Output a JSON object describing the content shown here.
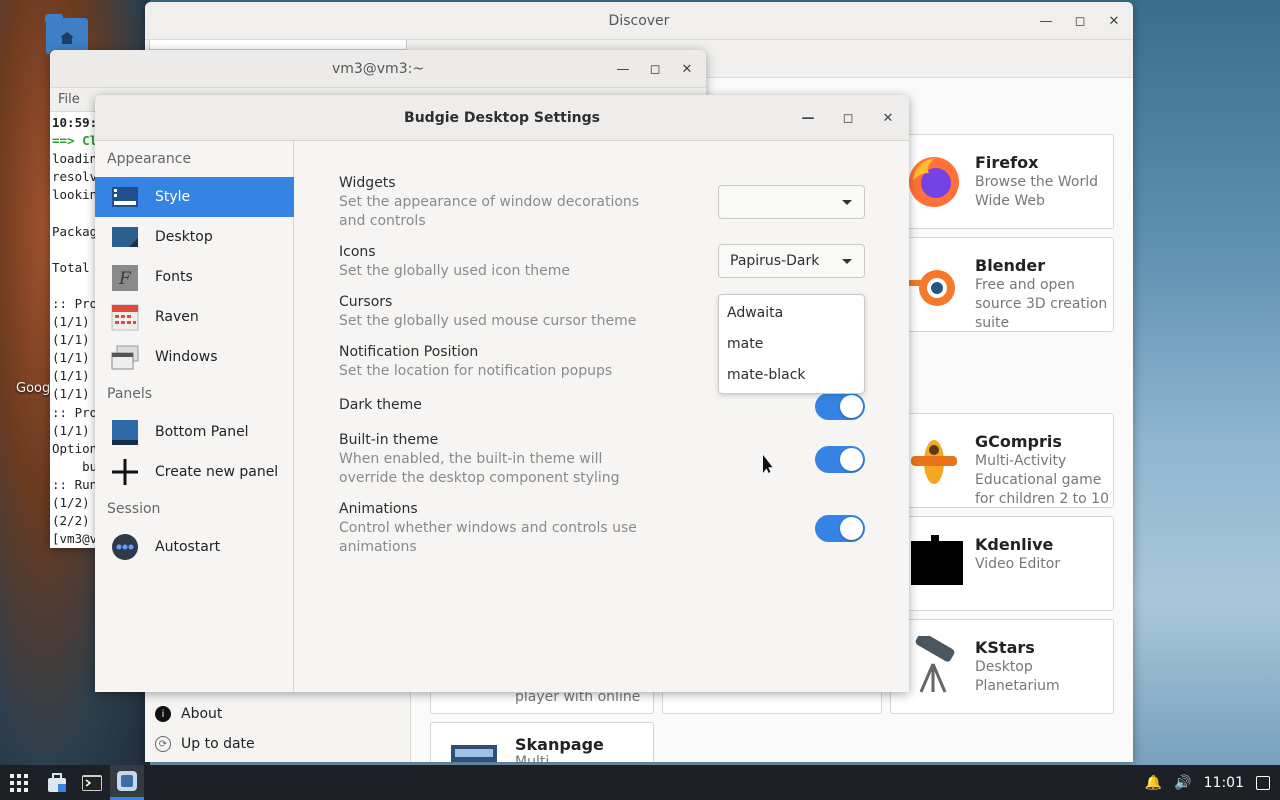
{
  "desktop": {
    "label": "Goog"
  },
  "discover": {
    "title": "Discover",
    "sidebar": {
      "about": "About",
      "up_to_date": "Up to date"
    },
    "cards": [
      {
        "name": "Firefox",
        "desc": "Browse the World Wide Web"
      },
      {
        "name": "Blender",
        "desc": "Free and open source 3D creation suite"
      },
      {
        "name": "GCompris",
        "desc": "Multi-Activity Educational game for children 2 to 10"
      },
      {
        "name": "Kdenlive",
        "desc": "Video Editor"
      },
      {
        "name": "KStars",
        "desc": "Desktop Planetarium"
      },
      {
        "name": "Skanpage",
        "desc": "Multi..."
      }
    ],
    "partial_card_text": "player with online"
  },
  "terminal": {
    "title": "vm3@vm3:~",
    "menu_file": "File",
    "lines": [
      "10:59:",
      "==> Cl",
      "loadin",
      "resolv",
      "lookin",
      "",
      "Packag",
      "",
      "Total",
      "",
      ":: Pro",
      "(1/1)",
      "(1/1)",
      "(1/1)",
      "(1/1)",
      "(1/1)",
      ":: Pro",
      "(1/1)",
      "Option",
      "    bu",
      ":: Run",
      "(1/2)",
      "(2/2)",
      "[vm3@v"
    ]
  },
  "budgie": {
    "title": "Budgie Desktop Settings",
    "sections": {
      "appearance": "Appearance",
      "panels": "Panels",
      "session": "Session"
    },
    "items": {
      "style": "Style",
      "desktop": "Desktop",
      "fonts": "Fonts",
      "raven": "Raven",
      "windows": "Windows",
      "bottom_panel": "Bottom Panel",
      "create_panel": "Create new panel",
      "autostart": "Autostart"
    },
    "options": {
      "widgets_title": "Widgets",
      "widgets_desc": "Set the appearance of window decorations and controls",
      "widgets_value": "",
      "icons_title": "Icons",
      "icons_desc": "Set the globally used icon theme",
      "icons_value": "Papirus-Dark",
      "cursors_title": "Cursors",
      "cursors_desc": "Set the globally used mouse cursor theme",
      "notif_title": "Notification Position",
      "notif_desc": "Set the location for notification popups",
      "dark_title": "Dark theme",
      "builtin_title": "Built-in theme",
      "builtin_desc": "When enabled, the built-in theme will override the desktop component styling",
      "anim_title": "Animations",
      "anim_desc": "Control whether windows and controls use animations"
    },
    "cursor_popup": [
      "Adwaita",
      "mate",
      "mate-black"
    ]
  },
  "taskbar": {
    "time": "11:01"
  },
  "colors": {
    "accent": "#3584e4",
    "taskbar": "#1d2125"
  }
}
